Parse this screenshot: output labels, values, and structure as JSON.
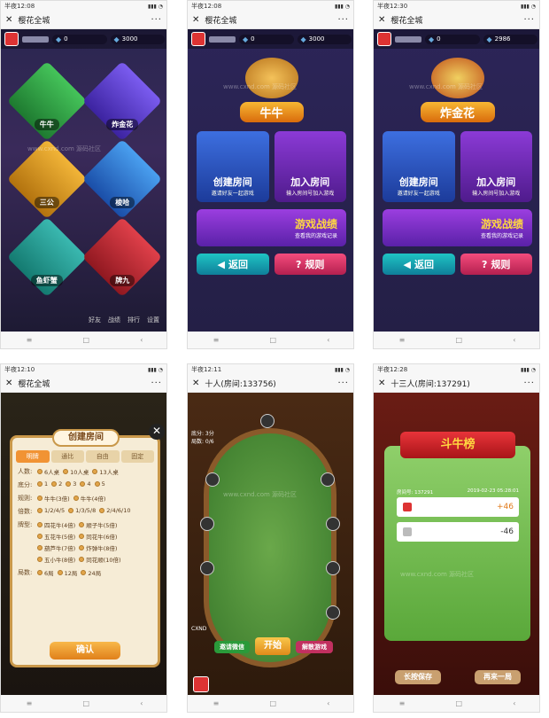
{
  "phones": [
    {
      "time": "半夜12:08",
      "title": "樱花全城"
    },
    {
      "time": "半夜12:08",
      "title": "樱花全城"
    },
    {
      "time": "半夜12:30",
      "title": "樱花全城"
    },
    {
      "time": "半夜12:10",
      "title": "樱花全城"
    },
    {
      "time": "半夜12:11",
      "title": "十人(房间:133756)"
    },
    {
      "time": "半夜12:28",
      "title": "十三人(房间:137291)"
    }
  ],
  "lobby": {
    "gems": "0",
    "coins": "3000",
    "games": [
      "牛牛",
      "炸金花",
      "三公",
      "梭哈",
      "鱼虾蟹",
      "牌九"
    ],
    "footer": [
      "好友",
      "战绩",
      "排行",
      "设置"
    ]
  },
  "menu1": {
    "gems": "0",
    "coins": "3000",
    "game_name": "牛牛",
    "create": "创建房间",
    "create_sub": "邀请好友一起游戏",
    "join": "加入房间",
    "join_sub": "输入房间号加入游戏",
    "record": "游戏战绩",
    "record_sub": "查看我的游戏记录",
    "back": "返回",
    "rules": "规则"
  },
  "menu2": {
    "gems": "0",
    "coins": "2986",
    "game_name": "炸金花",
    "create": "创建房间",
    "create_sub": "邀请好友一起游戏",
    "join": "加入房间",
    "join_sub": "输入房间号加入游戏",
    "record": "游戏战绩",
    "record_sub": "查看我的游戏记录",
    "back": "返回",
    "rules": "规则"
  },
  "create_room": {
    "title": "创建房间",
    "tabs": [
      "明牌",
      "通比",
      "自由",
      "固定"
    ],
    "rows": [
      {
        "label": "人数:",
        "options": [
          "6人桌",
          "10人桌",
          "13人桌"
        ]
      },
      {
        "label": "底分:",
        "options": [
          "1",
          "2",
          "3",
          "4",
          "5"
        ]
      },
      {
        "label": "规则:",
        "options": [
          "牛牛(3倍)",
          "牛牛(4倍)"
        ]
      },
      {
        "label": "倍数:",
        "options": [
          "1/2/4/5",
          "1/3/5/8",
          "2/4/6/10"
        ]
      },
      {
        "label": "牌型:",
        "options": [
          "四花牛(4倍)",
          "顺子牛(5倍)",
          "五花牛(5倍)",
          "同花牛(6倍)",
          "葫芦牛(7倍)",
          "炸弹牛(8倍)",
          "五小牛(8倍)",
          "同花顺(10倍)"
        ]
      },
      {
        "label": "局数:",
        "options": [
          "6局",
          "12局",
          "24局"
        ]
      }
    ],
    "confirm": "确认",
    "close": "✕"
  },
  "table": {
    "info": [
      "底分: 3分",
      "局数: 0/6"
    ],
    "btn_wechat": "邀请微信",
    "btn_start": "开始",
    "btn_dismiss": "解散游戏",
    "cxnd": "CXND"
  },
  "results": {
    "banner": "斗牛榜",
    "room": "房间号: 137291",
    "date": "2019-02-23 05:28:01",
    "players": [
      {
        "score": "+46"
      },
      {
        "score": "-46"
      }
    ],
    "btn_save": "长按保存",
    "btn_again": "再来一局"
  },
  "watermark": "www.cxnd.com  源码社区",
  "nav": [
    "≡",
    "□",
    "‹"
  ]
}
